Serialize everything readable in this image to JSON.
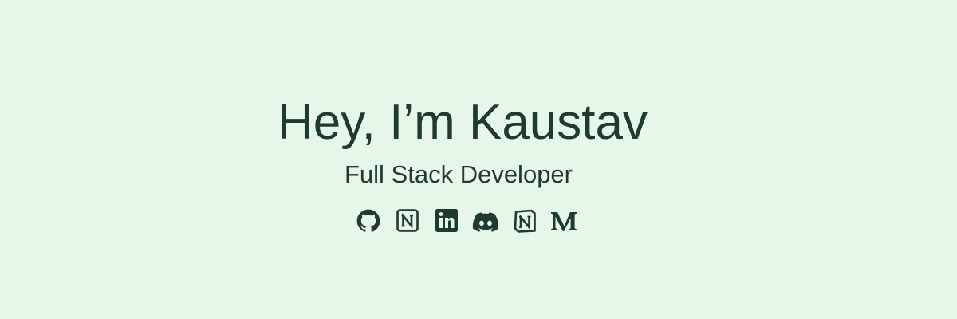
{
  "hero": {
    "headline": "Hey, I’m Kaustav",
    "subtitle": "Full Stack Developer"
  },
  "socials": [
    {
      "name": "github",
      "icon": "github-icon"
    },
    {
      "name": "notion",
      "icon": "notion-icon"
    },
    {
      "name": "linkedin",
      "icon": "linkedin-icon"
    },
    {
      "name": "discord",
      "icon": "discord-icon"
    },
    {
      "name": "notion",
      "icon": "notion-icon"
    },
    {
      "name": "medium",
      "icon": "medium-icon"
    }
  ],
  "colors": {
    "background": "#e6f7ea",
    "text": "#1f3a30"
  }
}
